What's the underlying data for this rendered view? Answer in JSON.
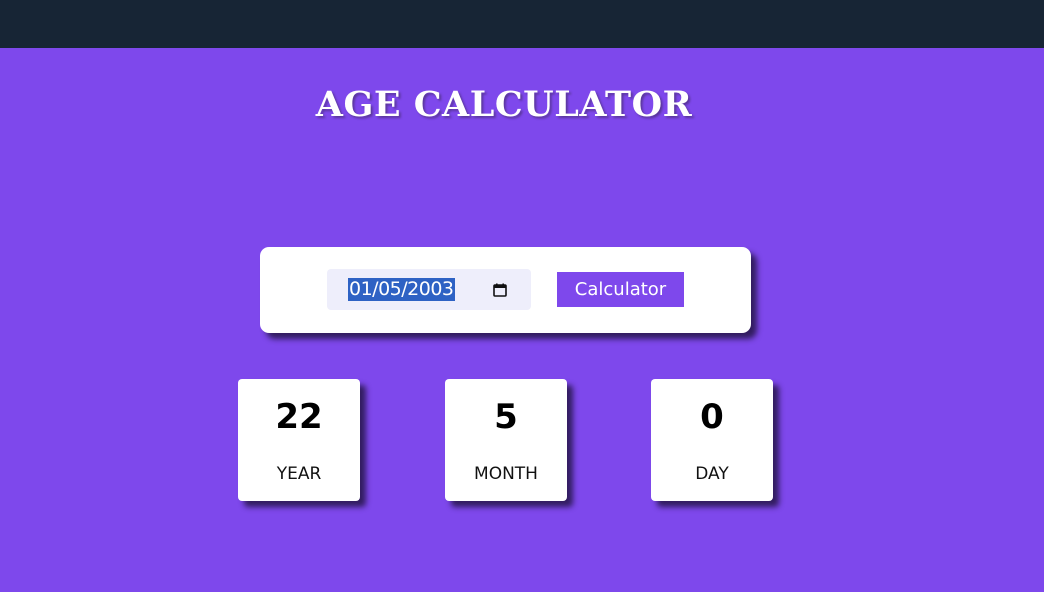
{
  "header": {
    "title": "AGE CALCULATOR"
  },
  "form": {
    "date_value": "01/05/2003",
    "calculate_label": "Calculator"
  },
  "results": {
    "years": {
      "value": "22",
      "label": "YEAR"
    },
    "months": {
      "value": "5",
      "label": "MONTH"
    },
    "days": {
      "value": "0",
      "label": "DAY"
    }
  },
  "icons": {
    "date_picker": "calendar-icon"
  },
  "colors": {
    "background": "#7e48ec",
    "topbar": "#172535",
    "button": "#7e48ec",
    "date_input_bg": "#eeeefb",
    "selection": "#2e62c4"
  }
}
